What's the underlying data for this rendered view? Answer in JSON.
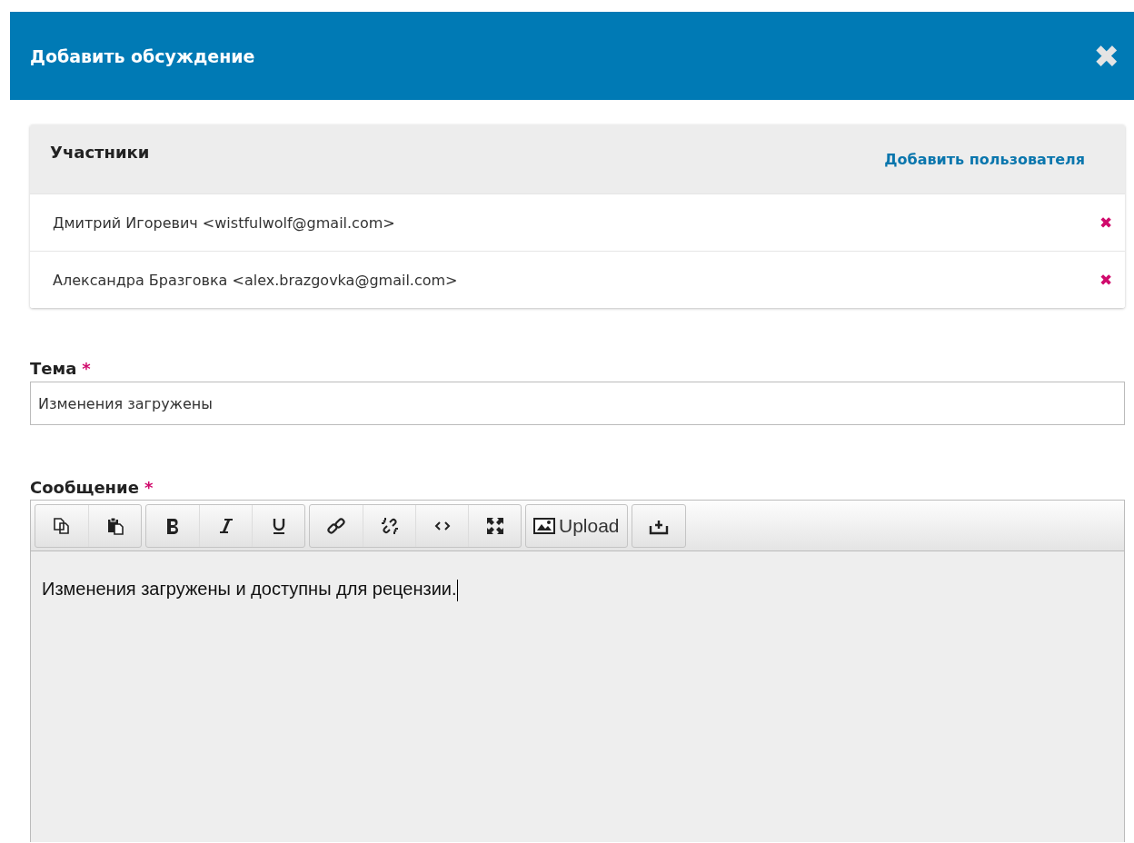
{
  "modal": {
    "title": "Добавить обсуждение",
    "close": "✖"
  },
  "participants": {
    "title": "Участники",
    "add_link": "Добавить пользователя",
    "remove": "✖",
    "items": [
      {
        "label": "Дмитрий Игоревич <wistfulwolf@gmail.com>"
      },
      {
        "label": "Александра Бразговка <alex.brazgovka@gmail.com>"
      }
    ]
  },
  "subject": {
    "label": "Тема",
    "required_mark": "*",
    "value": "Изменения загружены"
  },
  "message": {
    "label": "Сообщение",
    "required_mark": "*",
    "toolbar": [
      [
        {
          "kind": "copy"
        },
        {
          "kind": "paste"
        }
      ],
      [
        {
          "kind": "bold"
        },
        {
          "kind": "italic"
        },
        {
          "kind": "underline"
        }
      ],
      [
        {
          "kind": "link"
        },
        {
          "kind": "unlink"
        },
        {
          "kind": "code"
        },
        {
          "kind": "fullscreen"
        }
      ],
      [
        {
          "kind": "image",
          "label": "Upload"
        }
      ],
      [
        {
          "kind": "upload"
        }
      ]
    ],
    "value": "Изменения загружены и доступны для рецензии."
  }
}
